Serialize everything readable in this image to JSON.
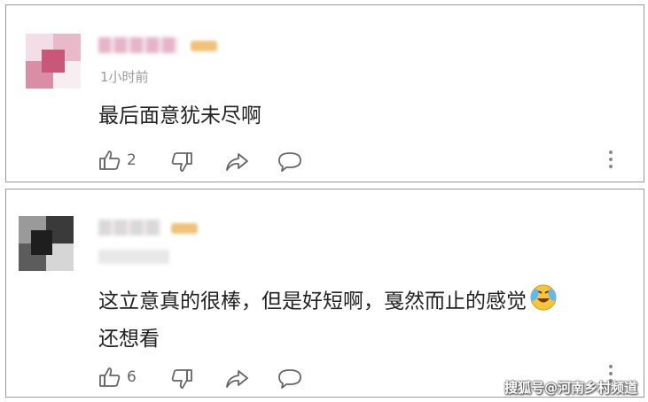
{
  "comments": [
    {
      "time": "1小时前",
      "text_lines": [
        "最后面意犹未尽啊"
      ],
      "likes": "2",
      "avatar_colors": [
        "#f3dde6",
        "#e8b9c8",
        "#d98ea6",
        "#f7eef2",
        "#c9577a",
        "#efd3de"
      ],
      "name_color": "#e6b3c8",
      "badge_color": "#f0c27a"
    },
    {
      "time": "",
      "text_lines": [
        "这立意真的很棒，但是好短啊，戛然而止的感觉",
        "还想看"
      ],
      "likes": "6",
      "avatar_colors": [
        "#9a9a9a",
        "#3a3a3a",
        "#5c5c5c",
        "#d6d6d6",
        "#1e1e1e",
        "#b5b5b5"
      ],
      "name_color": "#d9d9d9",
      "badge_color": "#f0c27a"
    }
  ],
  "icons": [
    "thumbs-up-icon",
    "thumbs-down-icon",
    "share-icon",
    "comment-icon",
    "more-vertical-icon",
    "crying-laughing-emoji-icon"
  ],
  "watermark": "搜狐号@河南乡村频道"
}
